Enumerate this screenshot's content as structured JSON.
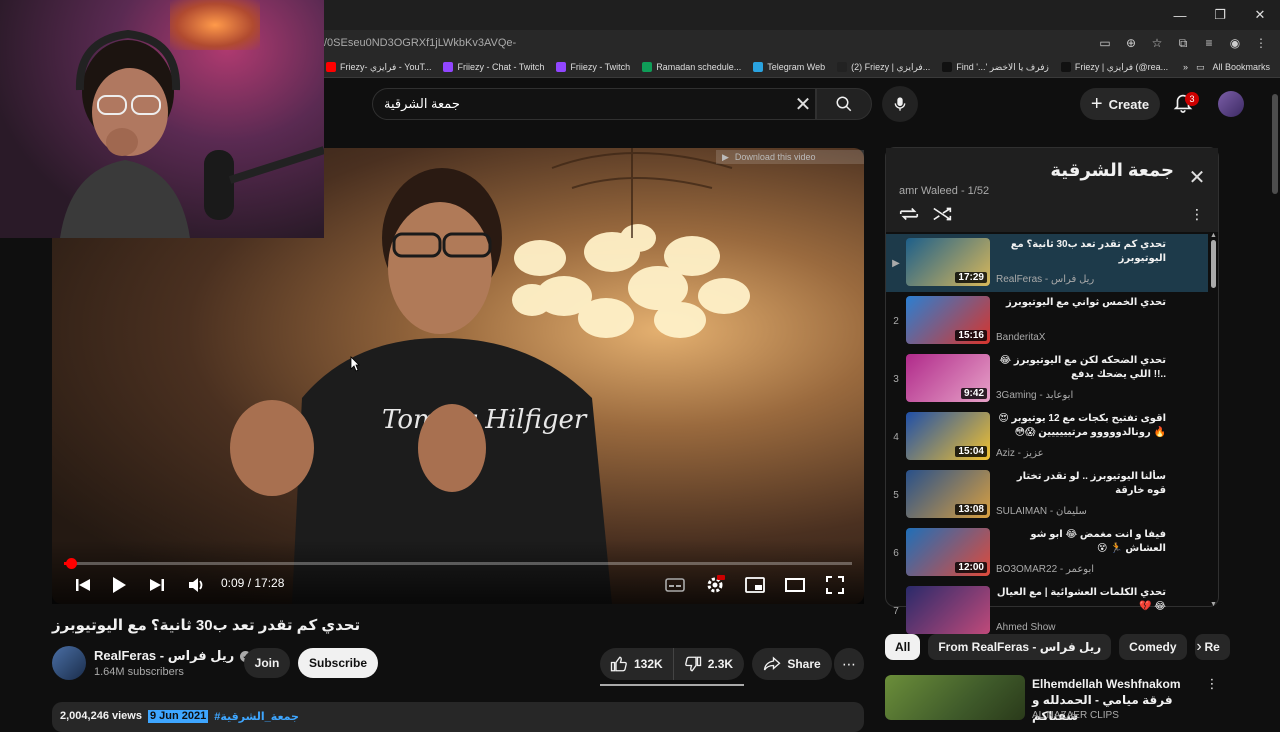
{
  "browser": {
    "url": "/0SEseu0ND3OGRXf1jLWkbKv3AVQe-",
    "bookmarks": [
      {
        "label": "Friezy- فرايزي - YouT...",
        "color": "#ff0000"
      },
      {
        "label": "Friiezy - Chat - Twitch",
        "color": "#9146ff"
      },
      {
        "label": "Friiezy - Twitch",
        "color": "#9146ff"
      },
      {
        "label": "Ramadan schedule...",
        "color": "#0f9d58"
      },
      {
        "label": "Telegram Web",
        "color": "#2aa3e0"
      },
      {
        "label": "(2) Friezy | فرايزي...",
        "color": "#222222"
      },
      {
        "label": "Find '...' زفرف يا الاخضر",
        "color": "#111111"
      },
      {
        "label": "Friezy | فرايزي (@rea...",
        "color": "#111111"
      }
    ],
    "all_bookmarks": "All Bookmarks"
  },
  "header": {
    "search_query": "جمعة الشرقية",
    "create_label": "Create",
    "notif_count": "3"
  },
  "player": {
    "time": "0:09 / 17:28",
    "progress_fraction": 0.009,
    "download_label": "Download this video"
  },
  "video": {
    "title": "تحدي كم تقدر تعد ب30 ثانية؟ مع اليوتيوبرز",
    "channel": "RealFeras - ريل فراس",
    "subscribers": "1.64M subscribers",
    "join_label": "Join",
    "subscribe_label": "Subscribe",
    "likes": "132K",
    "dislikes": "2.3K",
    "share_label": "Share",
    "views": "2,004,246 views",
    "date": "9 Jun 2021",
    "tag": "#جمعة_الشرقية"
  },
  "playlist": {
    "title": "جمعة الشرقية",
    "subtitle": "amr Waleed - 1/52",
    "items": [
      {
        "index": "▶",
        "title": "تحدي كم تقدر تعد ب30 ثانية؟ مع اليوتيوبرز",
        "channel": "RealFeras - ريل فراس",
        "duration": "17:29",
        "c1": "#1d5f8a",
        "c2": "#d9b85a"
      },
      {
        "index": "2",
        "title": "تحدي الخمس ثواني مع اليوتيوبرز",
        "channel": "BanderitaX",
        "duration": "15:16",
        "c1": "#2b7fd1",
        "c2": "#d9342b"
      },
      {
        "index": "3",
        "title": "تحدي الضحكه لكن مع اليوتيوبرز 😂 ..!! اللي يضحك يدفع",
        "channel": "3Gaming - ابوعابد",
        "duration": "9:42",
        "c1": "#b02a8a",
        "c2": "#e7a2c8"
      },
      {
        "index": "4",
        "title": "اقوى تفتيح بكجات مع 12 يوتيوبر 😍🔥 رونالدووووو مرتيييييين 😱😳",
        "channel": "Aziz - عزيز",
        "duration": "15:04",
        "c1": "#1f4fa8",
        "c2": "#f2c230"
      },
      {
        "index": "5",
        "title": "سألنا اليوتيوبرز .. لو تقدر تختار قوه خارقة",
        "channel": "SULAIMAN - سليمان",
        "duration": "13:08",
        "c1": "#28508a",
        "c2": "#d9a040"
      },
      {
        "index": "6",
        "title": "فيفا و انت مغمض 😂 ابو شو العشاش 🏃 😵",
        "channel": "BO3OMAR22 - ابوعمر",
        "duration": "12:00",
        "c1": "#1f6fb8",
        "c2": "#e04a3a"
      },
      {
        "index": "7",
        "title": "تحدي الكلمات العشوائية | مع العيال 😂 💔",
        "channel": "Ahmed Show",
        "duration": "",
        "c1": "#2a2a6a",
        "c2": "#c04a7a"
      }
    ]
  },
  "chips": [
    "All",
    "From RealFeras - ريل فراس",
    "Comedy",
    "Re"
  ],
  "recommended": {
    "title": "Elhemdellah Weshfnakom فرقة ميامي - الحمدلله و شفناكم",
    "channel": "AL NAZAER CLIPS"
  }
}
